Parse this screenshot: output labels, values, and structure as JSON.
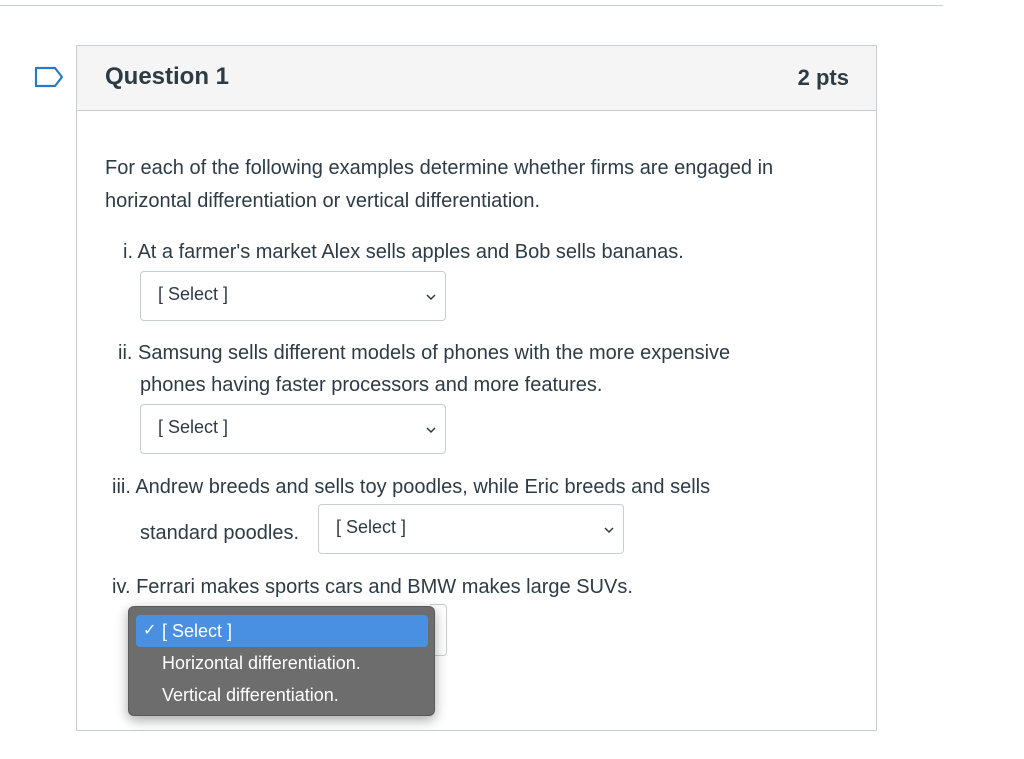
{
  "question": {
    "title": "Question 1",
    "points": "2 pts",
    "prompt_line1": "For each of the following examples determine whether firms are engaged in",
    "prompt_line2": "horizontal differentiation or vertical differentiation.",
    "items": [
      {
        "text": "i. At a farmer's market Alex sells apples and Bob sells bananas.",
        "selected": "[ Select ]"
      },
      {
        "text_line1": "ii. Samsung sells different models of phones with the more expensive",
        "text_line2": "phones having faster processors and more features.",
        "selected": "[ Select ]"
      },
      {
        "text_line1": "iii. Andrew breeds and sells toy poodles, while Eric breeds and sells",
        "text_line2": "standard poodles.",
        "selected": "[ Select ]"
      },
      {
        "text": "iv. Ferrari makes sports cars and BMW makes large SUVs.",
        "selected": "[ Select ]"
      }
    ]
  },
  "dropdown": {
    "options": [
      "[ Select ]",
      "Horizontal differentiation.",
      "Vertical differentiation."
    ],
    "checked_index": 0,
    "check_glyph": "✓"
  },
  "colors": {
    "text": "#2d3b45",
    "flag": "#2b7abc",
    "border": "#c7cdd1",
    "header_bg": "#f5f5f5",
    "dropdown_bg": "#6d6d6d",
    "highlight": "#4a90e2"
  },
  "icons": {
    "flag": "bookmark-flag-icon",
    "chevron": "chevron-down-icon"
  }
}
